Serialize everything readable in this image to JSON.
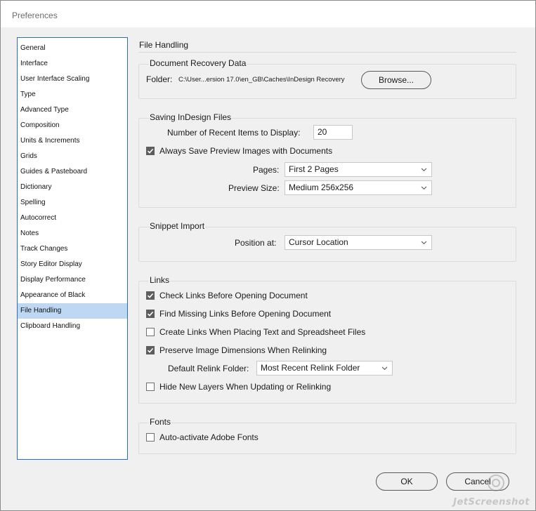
{
  "window": {
    "title": "Preferences"
  },
  "sidebar": {
    "items": [
      {
        "label": "General"
      },
      {
        "label": "Interface"
      },
      {
        "label": "User Interface Scaling"
      },
      {
        "label": "Type"
      },
      {
        "label": "Advanced Type"
      },
      {
        "label": "Composition"
      },
      {
        "label": "Units & Increments"
      },
      {
        "label": "Grids"
      },
      {
        "label": "Guides & Pasteboard"
      },
      {
        "label": "Dictionary"
      },
      {
        "label": "Spelling"
      },
      {
        "label": "Autocorrect"
      },
      {
        "label": "Notes"
      },
      {
        "label": "Track Changes"
      },
      {
        "label": "Story Editor Display"
      },
      {
        "label": "Display Performance"
      },
      {
        "label": "Appearance of Black"
      },
      {
        "label": "File Handling"
      },
      {
        "label": "Clipboard Handling"
      }
    ],
    "selected": "File Handling"
  },
  "page": {
    "title": "File Handling"
  },
  "recovery": {
    "legend": "Document Recovery Data",
    "folder_label": "Folder:",
    "folder_path": "C:\\User...ersion 17.0\\en_GB\\Caches\\InDesign Recovery",
    "browse_label": "Browse..."
  },
  "saving": {
    "legend": "Saving InDesign Files",
    "recent_label": "Number of Recent Items to Display:",
    "recent_value": "20",
    "preview_checkbox": {
      "label": "Always Save Preview Images with Documents",
      "checked": true
    },
    "pages_label": "Pages:",
    "pages_value": "First 2 Pages",
    "preview_size_label": "Preview Size:",
    "preview_size_value": "Medium 256x256"
  },
  "snippet": {
    "legend": "Snippet Import",
    "position_label": "Position at:",
    "position_value": "Cursor Location"
  },
  "links": {
    "legend": "Links",
    "check_links": {
      "label": "Check Links Before Opening Document",
      "checked": true
    },
    "find_missing": {
      "label": "Find Missing Links Before Opening Document",
      "checked": true
    },
    "create_links": {
      "label": "Create Links When Placing Text and Spreadsheet Files",
      "checked": false
    },
    "preserve_dims": {
      "label": "Preserve Image Dimensions When Relinking",
      "checked": true
    },
    "relink_folder_label": "Default Relink Folder:",
    "relink_folder_value": "Most Recent Relink Folder",
    "hide_layers": {
      "label": "Hide New Layers When Updating or Relinking",
      "checked": false
    }
  },
  "fonts": {
    "legend": "Fonts",
    "auto_activate": {
      "label": "Auto-activate Adobe Fonts",
      "checked": false
    }
  },
  "buttons": {
    "ok_label": "OK",
    "cancel_label": "Cancel"
  },
  "watermark": "JetScreenshot",
  "colors": {
    "selection": "#bed7f3",
    "sidebar_border": "#2a6ebf",
    "checkbox_checked": "#5d5d5d"
  }
}
